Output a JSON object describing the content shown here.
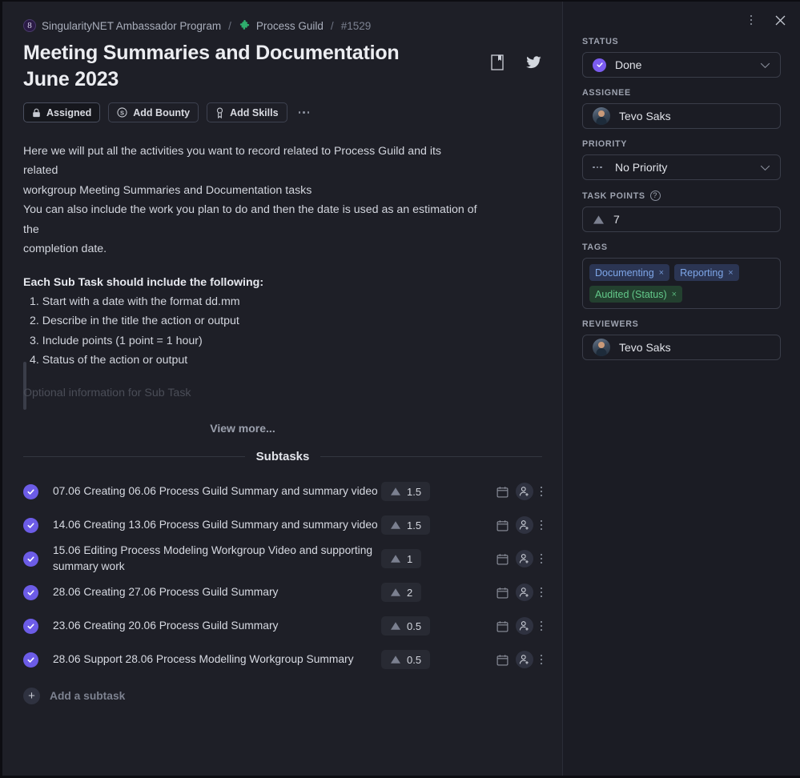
{
  "window": {
    "menu_icon": "vertical-dots-icon",
    "close_icon": "close-icon"
  },
  "breadcrumb": {
    "org": "SingularityNET Ambassador Program",
    "org_icon": "singularitynet-logo-icon",
    "guild": "Process Guild",
    "guild_icon": "puzzle-piece-icon",
    "separator": "/",
    "task_id": "#1529"
  },
  "task": {
    "title": "Meeting Summaries and Documentation June 2023",
    "bookmark_icon": "bookmark-icon",
    "twitter_icon": "twitter-icon",
    "actions": [
      {
        "label": "Assigned",
        "icon": "lock-icon",
        "filled": true
      },
      {
        "label": "Add Bounty",
        "icon": "dollar-circle-icon",
        "filled": false
      },
      {
        "label": "Add Skills",
        "icon": "medal-icon",
        "filled": false
      }
    ],
    "more_icon": "horizontal-dots-icon"
  },
  "description": {
    "para1_line1": "Here we will put all the activities you want to record related to Process Guild and its related",
    "para1_line2": "workgroup Meeting Summaries and Documentation tasks",
    "para2_line1": "You can also include the work you plan to do and then the date is used as an estimation of the",
    "para2_line2": "completion date.",
    "heading": "Each Sub Task should include the following:",
    "items": [
      "1. Start with a date with the format dd.mm",
      "2. Describe in the title the action or output",
      "3. Include points (1 point = 1 hour)",
      "4. Status of the action or output"
    ],
    "faded_line": "Optional information for Sub Task",
    "view_more": "View more..."
  },
  "subtasks": {
    "header": "Subtasks",
    "add_label": "Add a subtask",
    "add_icon": "plus-icon",
    "row_icons": {
      "checkbox": "check-circle-icon",
      "points": "triangle-icon",
      "calendar": "calendar-icon",
      "assign": "add-person-icon",
      "menu": "vertical-dots-icon"
    },
    "items": [
      {
        "title": "07.06 Creating 06.06 Process Guild Summary and summary video",
        "points": "1.5",
        "done": true
      },
      {
        "title": "14.06 Creating 13.06 Process Guild Summary and summary video",
        "points": "1.5",
        "done": true
      },
      {
        "title": "15.06 Editing Process Modeling Workgroup Video and supporting summary work",
        "points": "1",
        "done": true
      },
      {
        "title": "28.06 Creating 27.06 Process Guild Summary",
        "points": "2",
        "done": true
      },
      {
        "title": "23.06 Creating 20.06 Process Guild Summary",
        "points": "0.5",
        "done": true
      },
      {
        "title": "28.06 Support 28.06 Process Modelling Workgroup Summary",
        "points": "0.5",
        "done": true
      }
    ]
  },
  "sidebar": {
    "status": {
      "label": "STATUS",
      "value": "Done",
      "icon": "check-circle-icon",
      "chevron": "chevron-down-icon"
    },
    "assignee": {
      "label": "ASSIGNEE",
      "value": "Tevo Saks",
      "avatar": "user-avatar"
    },
    "priority": {
      "label": "PRIORITY",
      "value": "No Priority",
      "icon": "priority-dots-icon",
      "chevron": "chevron-down-icon"
    },
    "task_points": {
      "label": "TASK POINTS",
      "help_icon": "question-mark-icon",
      "value": "7",
      "icon": "triangle-icon"
    },
    "tags": {
      "label": "TAGS",
      "items": [
        {
          "name": "Documenting",
          "color": "blue",
          "remove": "×"
        },
        {
          "name": "Reporting",
          "color": "blue",
          "remove": "×"
        },
        {
          "name": "Audited (Status)",
          "color": "green",
          "remove": "×"
        }
      ]
    },
    "reviewers": {
      "label": "REVIEWERS",
      "value": "Tevo Saks",
      "avatar": "user-avatar"
    }
  },
  "colors": {
    "accent_purple": "#7b5cf0",
    "tag_blue": "#7ea6e8",
    "tag_green": "#63c98a",
    "guild_green": "#2fae6d",
    "bg_main": "#1e1f27",
    "bg_sidebar": "#1b1c24"
  }
}
